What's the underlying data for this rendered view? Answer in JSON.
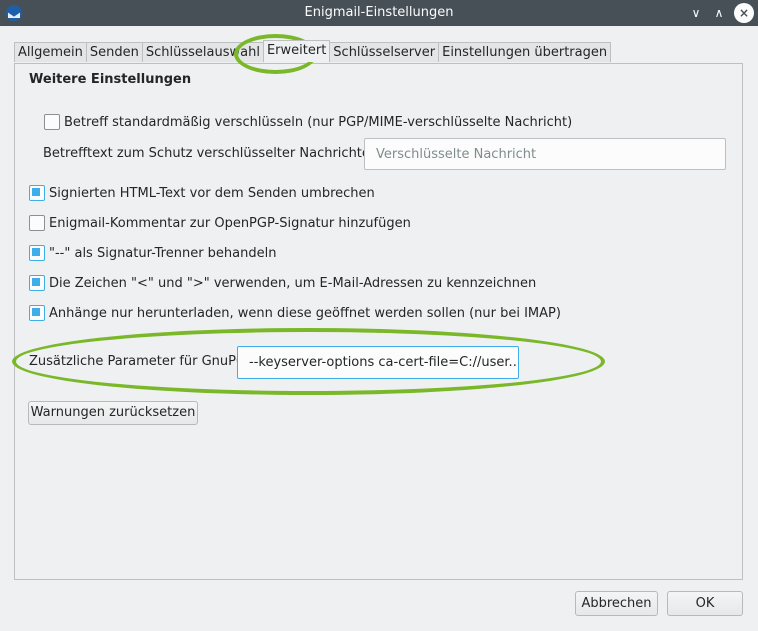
{
  "window": {
    "title": "Enigmail-Einstellungen",
    "icon": "thunderbird-icon",
    "minimize_glyph": "∨",
    "maximize_glyph": "∧",
    "close_glyph": "×"
  },
  "tabs": [
    {
      "label": "Allgemein",
      "active": false
    },
    {
      "label": "Senden",
      "active": false
    },
    {
      "label": "Schlüsselauswahl",
      "active": false
    },
    {
      "label": "Erweitert",
      "active": true
    },
    {
      "label": "Schlüsselserver",
      "active": false
    },
    {
      "label": "Einstellungen übertragen",
      "active": false
    }
  ],
  "panel": {
    "section_title": "Weitere Einstellungen",
    "subject_encrypt": {
      "label": "Betreff standardmäßig verschlüsseln (nur PGP/MIME-verschlüsselte Nachricht)",
      "checked": false
    },
    "subject_text": {
      "label": "Betrefftext zum Schutz verschlüsselter Nachrichten",
      "placeholder": "Verschlüsselte Nachricht"
    },
    "options": [
      {
        "label": "Signierten HTML-Text vor dem Senden umbrechen",
        "checked": true
      },
      {
        "label": "Enigmail-Kommentar zur OpenPGP-Signatur hinzufügen",
        "checked": false
      },
      {
        "label": "\"--\" als Signatur-Trenner behandeln",
        "checked": true
      },
      {
        "label": "Die Zeichen \"<\" und \">\" verwenden, um E-Mail-Adressen zu kennzeichnen",
        "checked": true
      },
      {
        "label": "Anhänge nur herunterladen, wenn diese geöffnet werden sollen (nur bei IMAP)",
        "checked": true
      }
    ],
    "gnupg_params": {
      "label": "Zusätzliche Parameter für GnuPG",
      "value": "--keyserver-options ca-cert-file=C://user..."
    },
    "reset_warnings_label": "Warnungen zurücksetzen"
  },
  "footer": {
    "cancel_label": "Abbrechen",
    "ok_label": "OK"
  },
  "colors": {
    "titlebar": "#475057",
    "accent": "#3daee9",
    "highlight_ellipse": "#7ab829",
    "background": "#eff0f1"
  }
}
